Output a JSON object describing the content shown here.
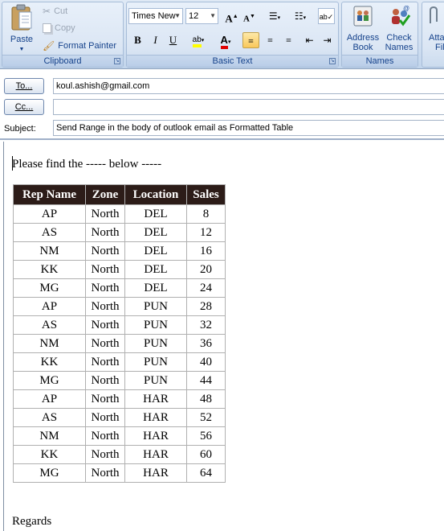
{
  "ribbon": {
    "clipboard": {
      "group_label": "Clipboard",
      "paste_label": "Paste",
      "cut_label": "Cut",
      "copy_label": "Copy",
      "format_painter_label": "Format Painter"
    },
    "basic_text": {
      "group_label": "Basic Text",
      "font_name": "Times New",
      "font_size": "12",
      "bold": "B",
      "italic": "I",
      "underline": "U"
    },
    "names": {
      "group_label": "Names",
      "address_book_line1": "Address",
      "address_book_line2": "Book",
      "check_names_line1": "Check",
      "check_names_line2": "Names"
    },
    "include": {
      "attach_line1": "Atta",
      "attach_line2": "Fil"
    }
  },
  "address": {
    "to_label": "To...",
    "to_value": "koul.ashish@gmail.com",
    "cc_label": "Cc...",
    "cc_value": "",
    "subject_label": "Subject:",
    "subject_value": "Send Range in the body of outlook email as Formatted Table"
  },
  "body": {
    "intro": "Please find the ----- below -----",
    "table": {
      "headers": [
        "Rep Name",
        "Zone",
        "Location",
        "Sales"
      ],
      "rows": [
        [
          "AP",
          "North",
          "DEL",
          "8"
        ],
        [
          "AS",
          "North",
          "DEL",
          "12"
        ],
        [
          "NM",
          "North",
          "DEL",
          "16"
        ],
        [
          "KK",
          "North",
          "DEL",
          "20"
        ],
        [
          "MG",
          "North",
          "DEL",
          "24"
        ],
        [
          "AP",
          "North",
          "PUN",
          "28"
        ],
        [
          "AS",
          "North",
          "PUN",
          "32"
        ],
        [
          "NM",
          "North",
          "PUN",
          "36"
        ],
        [
          "KK",
          "North",
          "PUN",
          "40"
        ],
        [
          "MG",
          "North",
          "PUN",
          "44"
        ],
        [
          "AP",
          "North",
          "HAR",
          "48"
        ],
        [
          "AS",
          "North",
          "HAR",
          "52"
        ],
        [
          "NM",
          "North",
          "HAR",
          "56"
        ],
        [
          "KK",
          "North",
          "HAR",
          "60"
        ],
        [
          "MG",
          "North",
          "HAR",
          "64"
        ]
      ]
    },
    "closing": "Regards"
  },
  "colors": {
    "table_header_bg": "#2c1c18",
    "ribbon_label": "#15428b",
    "highlight_yellow": "#ffff00",
    "font_color_red": "#e00000"
  }
}
